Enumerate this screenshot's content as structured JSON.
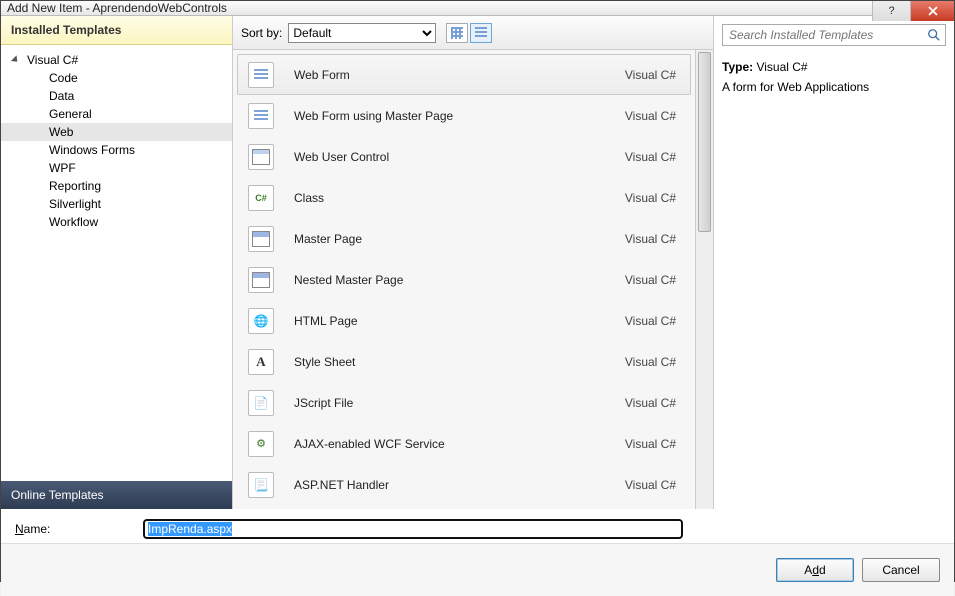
{
  "window": {
    "title": "Add New Item - AprendendoWebControls"
  },
  "sidebar": {
    "header": "Installed Templates",
    "root": "Visual C#",
    "items": [
      {
        "label": "Code",
        "selected": false
      },
      {
        "label": "Data",
        "selected": false
      },
      {
        "label": "General",
        "selected": false
      },
      {
        "label": "Web",
        "selected": true
      },
      {
        "label": "Windows Forms",
        "selected": false
      },
      {
        "label": "WPF",
        "selected": false
      },
      {
        "label": "Reporting",
        "selected": false
      },
      {
        "label": "Silverlight",
        "selected": false
      },
      {
        "label": "Workflow",
        "selected": false
      }
    ],
    "footer": "Online Templates"
  },
  "sortbar": {
    "label": "Sort by:",
    "selected": "Default"
  },
  "search": {
    "placeholder": "Search Installed Templates"
  },
  "templates": [
    {
      "name": "Web Form",
      "lang": "Visual C#",
      "icon": "ic-form",
      "selected": true
    },
    {
      "name": "Web Form using Master Page",
      "lang": "Visual C#",
      "icon": "ic-form",
      "selected": false
    },
    {
      "name": "Web User Control",
      "lang": "Visual C#",
      "icon": "ic-usercontrol",
      "selected": false
    },
    {
      "name": "Class",
      "lang": "Visual C#",
      "icon": "ic-class",
      "selected": false
    },
    {
      "name": "Master Page",
      "lang": "Visual C#",
      "icon": "ic-master",
      "selected": false
    },
    {
      "name": "Nested Master Page",
      "lang": "Visual C#",
      "icon": "ic-master",
      "selected": false
    },
    {
      "name": "HTML Page",
      "lang": "Visual C#",
      "icon": "ic-html",
      "selected": false
    },
    {
      "name": "Style Sheet",
      "lang": "Visual C#",
      "icon": "ic-css",
      "selected": false
    },
    {
      "name": "JScript File",
      "lang": "Visual C#",
      "icon": "ic-js",
      "selected": false
    },
    {
      "name": "AJAX-enabled WCF Service",
      "lang": "Visual C#",
      "icon": "ic-svc",
      "selected": false
    },
    {
      "name": "ASP.NET Handler",
      "lang": "Visual C#",
      "icon": "ic-hnd",
      "selected": false
    }
  ],
  "details": {
    "type_label": "Type:",
    "type_value": "Visual C#",
    "description": "A form for Web Applications"
  },
  "name_field": {
    "label_pre": "N",
    "label_post": "ame:",
    "value": "ImpRenda.aspx"
  },
  "buttons": {
    "add_pre": "A",
    "add_ul": "d",
    "add_post": "d",
    "cancel": "Cancel"
  }
}
